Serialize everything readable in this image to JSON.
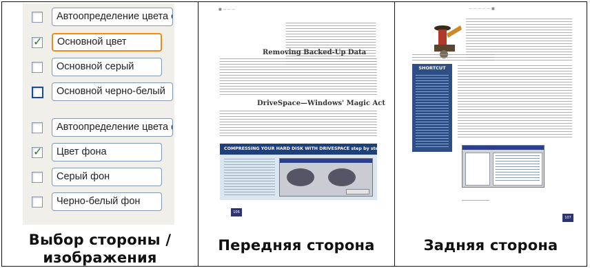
{
  "options": {
    "color_group": [
      {
        "label": "Автоопределение цвета осн",
        "checked": false,
        "selected": false
      },
      {
        "label": "Основной цвет",
        "checked": true,
        "selected": true
      },
      {
        "label": "Основной серый",
        "checked": false,
        "selected": false
      },
      {
        "label": "Основной черно-белый",
        "checked": false,
        "selected": false
      }
    ],
    "background_group": [
      {
        "label": "Автоопределение цвета фог",
        "checked": false,
        "selected": false
      },
      {
        "label": "Цвет фона",
        "checked": true,
        "selected": false
      },
      {
        "label": "Серый фон",
        "checked": false,
        "selected": false
      },
      {
        "label": "Черно-белый фон",
        "checked": false,
        "selected": false
      }
    ]
  },
  "captions": {
    "side_select": "Выбор стороны / изображения",
    "front": "Передняя сторона",
    "back": "Задняя сторона"
  },
  "front_page": {
    "heading1": "Removing Backed-Up Data",
    "heading2": "DriveSpace—Windows' Magic Act",
    "banner": "COMPRESSING YOUR HARD DISK WITH DRIVESPACE step by step",
    "page_number": "106"
  },
  "back_page": {
    "sidebar_title": "SHORTCUT",
    "page_number": "107"
  },
  "colors": {
    "accent_orange": "#f08a1a",
    "banner_blue": "#1e3f7a",
    "shortcut_blue": "#2d4f86",
    "page_num_navy": "#2b3470"
  }
}
